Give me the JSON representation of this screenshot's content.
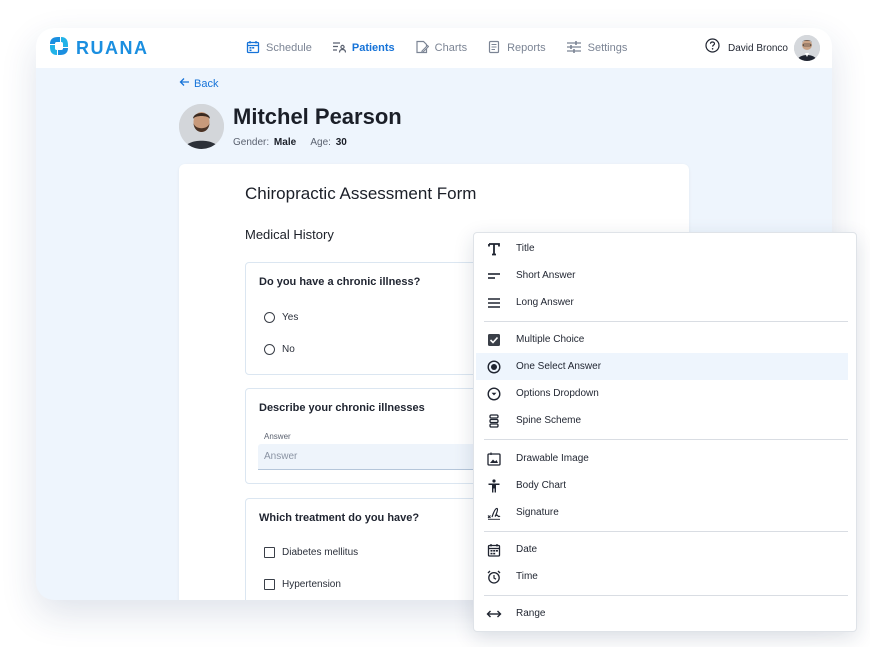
{
  "brand": {
    "name": "RUANA",
    "color": "#1b8fe0"
  },
  "nav": {
    "items": [
      {
        "label": "Schedule",
        "icon": "calendar-icon"
      },
      {
        "label": "Patients",
        "icon": "patients-list-icon",
        "active": true
      },
      {
        "label": "Charts",
        "icon": "chart-doc-icon"
      },
      {
        "label": "Reports",
        "icon": "report-icon"
      },
      {
        "label": "Settings",
        "icon": "sliders-icon"
      }
    ]
  },
  "user": {
    "name": "David Bronco",
    "help_icon": "help-icon"
  },
  "back_label": "Back",
  "patient": {
    "name": "Mitchel Pearson",
    "gender_label": "Gender:",
    "gender": "Male",
    "age_label": "Age:",
    "age": "30"
  },
  "form": {
    "title": "Chiropractic Assessment Form",
    "section": "Medical History",
    "questions": [
      {
        "label": "Do you have a chronic illness?",
        "type": "radio",
        "options": [
          "Yes",
          "No"
        ]
      },
      {
        "label": "Describe your chronic illnesses",
        "type": "text",
        "field_label": "Answer",
        "placeholder": "Answer"
      },
      {
        "label": "Which treatment do you have?",
        "type": "checkbox",
        "options": [
          "Diabetes mellitus",
          "Hypertension"
        ]
      }
    ]
  },
  "menu": {
    "groups": [
      [
        {
          "label": "Title",
          "icon": "title-text-icon"
        },
        {
          "label": "Short Answer",
          "icon": "short-answer-icon"
        },
        {
          "label": "Long Answer",
          "icon": "long-answer-icon"
        }
      ],
      [
        {
          "label": "Multiple Choice",
          "icon": "checkbox-checked-icon"
        },
        {
          "label": "One Select Answer",
          "icon": "radio-selected-icon",
          "active": true
        },
        {
          "label": "Options Dropdown",
          "icon": "dropdown-circle-icon"
        },
        {
          "label": "Spine Scheme",
          "icon": "spine-icon"
        }
      ],
      [
        {
          "label": "Drawable Image",
          "icon": "image-icon"
        },
        {
          "label": "Body Chart",
          "icon": "body-figure-icon"
        },
        {
          "label": "Signature",
          "icon": "signature-icon"
        }
      ],
      [
        {
          "label": "Date",
          "icon": "calendar-icon"
        },
        {
          "label": "Time",
          "icon": "alarm-clock-icon"
        }
      ],
      [
        {
          "label": "Range",
          "icon": "range-arrows-icon"
        }
      ]
    ]
  },
  "colors": {
    "accent": "#1673d8",
    "background": "#eef5fd",
    "highlight": "#eef5fd"
  }
}
